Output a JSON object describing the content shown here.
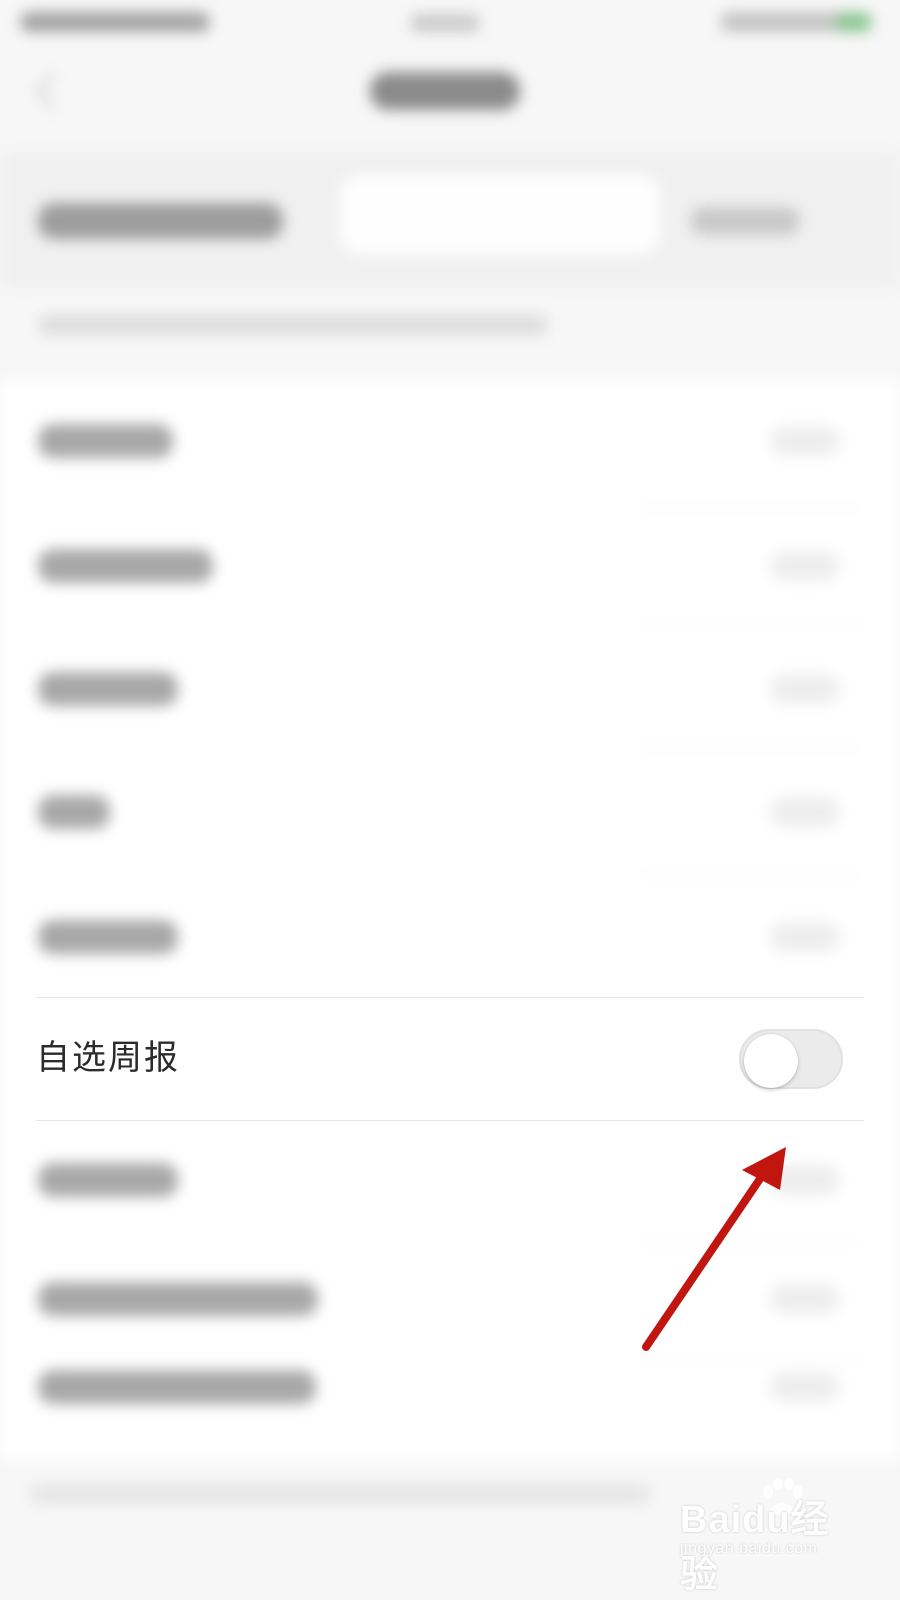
{
  "settings": {
    "weekly_report_label": "自选周报",
    "weekly_report_toggle": "off"
  },
  "watermark": {
    "brand": "Baidu",
    "brand_cn": "经验",
    "url": "jingyan.baidu.com"
  },
  "annotation": {
    "arrow_color": "#c0160f",
    "target": "weekly-report-toggle"
  },
  "colors": {
    "background": "#f7f7f7",
    "row": "#ffffff",
    "text": "#2b2b2b",
    "toggle_off": "#ebebeb"
  }
}
